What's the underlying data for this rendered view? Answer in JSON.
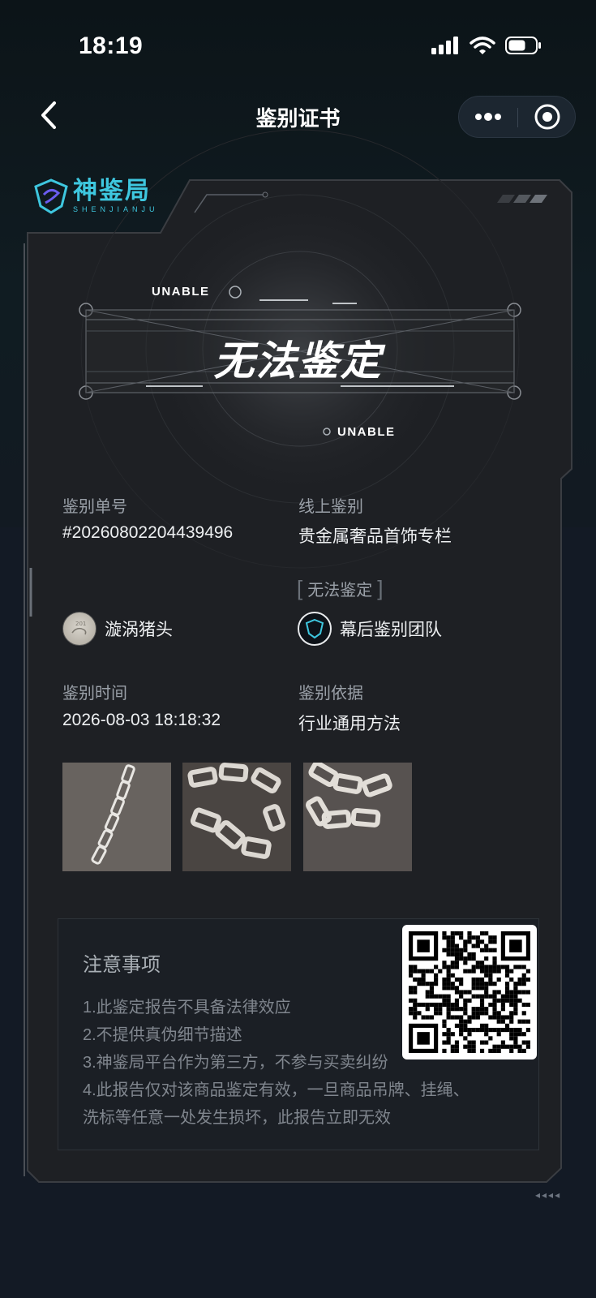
{
  "status_bar": {
    "time": "18:19"
  },
  "nav": {
    "title": "鉴别证书"
  },
  "logo": {
    "name": "神鉴局",
    "pinyin": "SHENJIANJU"
  },
  "result": {
    "tag_top": "UNABLE",
    "title": "无法鉴定",
    "tag_bottom": "UNABLE"
  },
  "fields": {
    "order_label": "鉴别单号",
    "order_value": "#20260802204439496",
    "type_label": "线上鉴别",
    "type_value": "贵金属奢品首饰专栏",
    "status_tag": "无法鉴定",
    "user_name": "漩涡猪头",
    "team_name": "幕后鉴别团队",
    "time_label": "鉴别时间",
    "time_value": "2026-08-03 18:18:32",
    "basis_label": "鉴别依据",
    "basis_value": "行业通用方法"
  },
  "photos": [
    "chain-photo-1",
    "chain-photo-2",
    "chain-photo-3"
  ],
  "notice": {
    "title": "注意事项",
    "items": [
      "1.此鉴定报告不具备法律效应",
      "2.不提供真伪细节描述",
      "3.神鉴局平台作为第三方，不参与买卖纠纷",
      "4.此报告仅对该商品鉴定有效，一旦商品吊牌、挂绳、",
      "洗标等任意一处发生损坏，此报告立即无效"
    ]
  },
  "colors": {
    "accent": "#3ec7df",
    "card_bg": "#1e2024",
    "page_bg": "#141a24"
  }
}
